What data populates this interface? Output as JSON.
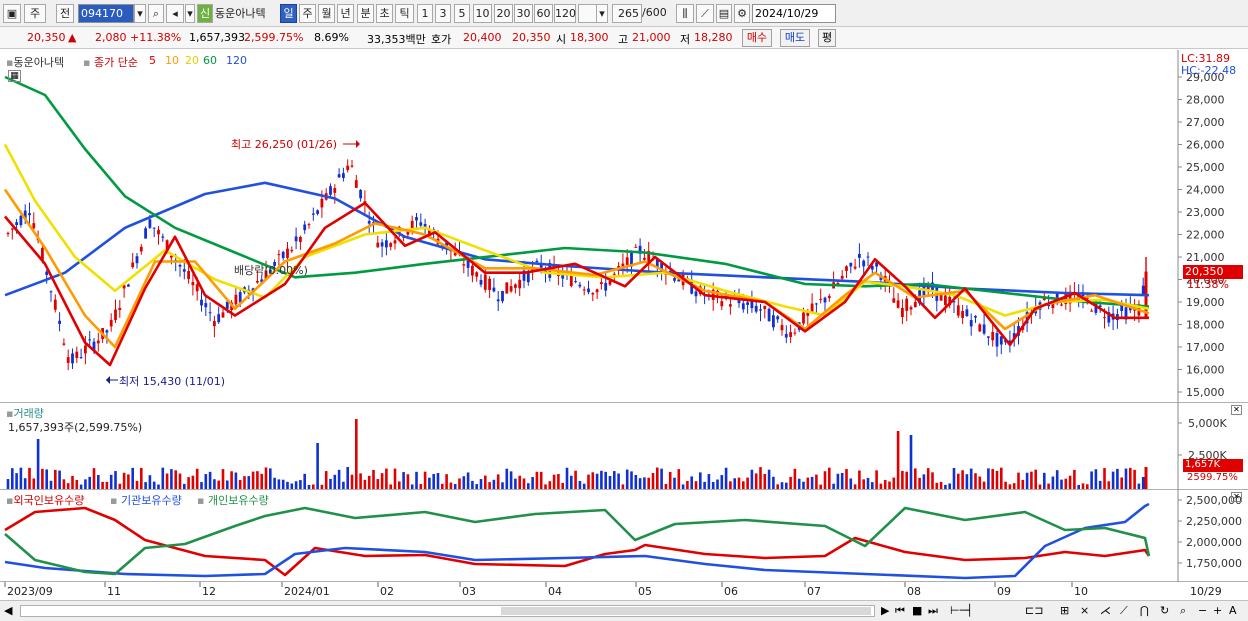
{
  "toolbar": {
    "period_jump": "주",
    "prev_label": "전",
    "code": "094170",
    "stock_name": "동운아나텍",
    "credit_badge": "신",
    "period_tabs": [
      "일",
      "주",
      "월",
      "년",
      "분",
      "초",
      "틱"
    ],
    "interval_tabs": [
      "1",
      "3",
      "5",
      "10",
      "20",
      "30",
      "60",
      "120"
    ],
    "bar_count": "265",
    "bar_total": "/600",
    "date": "2024/10/29"
  },
  "quote": {
    "price": "20,350",
    "change_arrow": "▲",
    "change": "2,080",
    "change_pct": "+11.38%",
    "volume": "1,657,393",
    "volume_ratio": "2,599.75%",
    "turnover": "8.69%",
    "amount": "33,353백만",
    "bid_label": "호가",
    "bid1": "20,400",
    "bid2": "20,350",
    "open_label": "시",
    "open": "18,300",
    "high_label": "고",
    "high": "21,000",
    "low_label": "저",
    "low": "18,280",
    "buy_label": "매수",
    "sell_label": "매도",
    "eval_label": "평"
  },
  "price_panel": {
    "legend_name": "동운아나텍",
    "legend_ma": "종가 단순",
    "ma_periods": [
      "5",
      "10",
      "20",
      "60",
      "120"
    ],
    "ma_colors": [
      "#e00000",
      "#ff9a00",
      "#f0e000",
      "#009a40",
      "#2050e0"
    ],
    "annotation_high": "최고 26,250 (01/26)",
    "annotation_low": "최저 15,430 (11/01)",
    "dividend_label": "배당락(0.00%)",
    "lc": "LC:31.89",
    "hc": "HC:-22.48",
    "y_ticks": [
      "29,000",
      "28,000",
      "27,000",
      "26,000",
      "25,000",
      "24,000",
      "23,000",
      "22,000",
      "21,000",
      "20,000",
      "19,000",
      "18,000",
      "17,000",
      "16,000",
      "15,000"
    ],
    "last_price_tag": "20,350",
    "last_pct_tag": "11.38%"
  },
  "volume_panel": {
    "title": "거래량",
    "value": "1,657,393주(2,599.75%)",
    "y_ticks": [
      "5,000K",
      "2,500K"
    ],
    "tag_value": "1,657K",
    "tag_pct": "2599.75%"
  },
  "holdings_panel": {
    "legend": [
      "외국인보유수량",
      "기관보유수량",
      "개인보유수량"
    ],
    "colors": [
      "#e00000",
      "#2050e0",
      "#20904a"
    ],
    "y_ticks": [
      "2,500,000",
      "2,250,000",
      "2,000,000",
      "1,750,000"
    ]
  },
  "x_axis": {
    "labels": [
      "2023/09",
      "11",
      "12",
      "2024/01",
      "02",
      "03",
      "04",
      "05",
      "06",
      "07",
      "08",
      "09",
      "10"
    ],
    "right_label": "10/29"
  }
}
